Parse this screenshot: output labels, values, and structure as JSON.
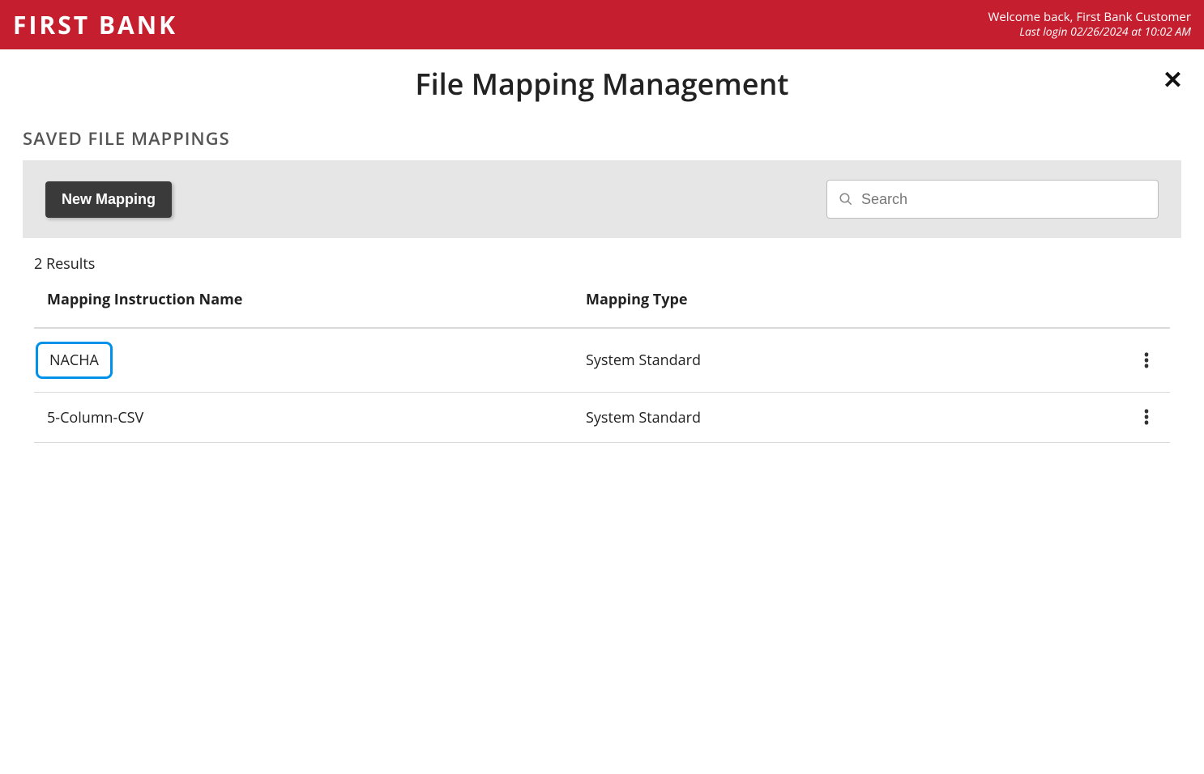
{
  "header": {
    "logo_text": "FIRST BANK",
    "welcome": "Welcome back, First Bank Customer",
    "last_login": "Last login 02/26/2024 at 10:02 AM"
  },
  "page": {
    "title": "File Mapping Management",
    "section_label": "SAVED FILE MAPPINGS",
    "new_mapping_label": "New Mapping",
    "search_placeholder": "Search",
    "results_text": "2 Results"
  },
  "columns": {
    "name": "Mapping Instruction Name",
    "type": "Mapping Type"
  },
  "rows": [
    {
      "name": "NACHA",
      "type": "System Standard",
      "highlighted": true
    },
    {
      "name": "5-Column-CSV",
      "type": "System Standard",
      "highlighted": false
    }
  ]
}
